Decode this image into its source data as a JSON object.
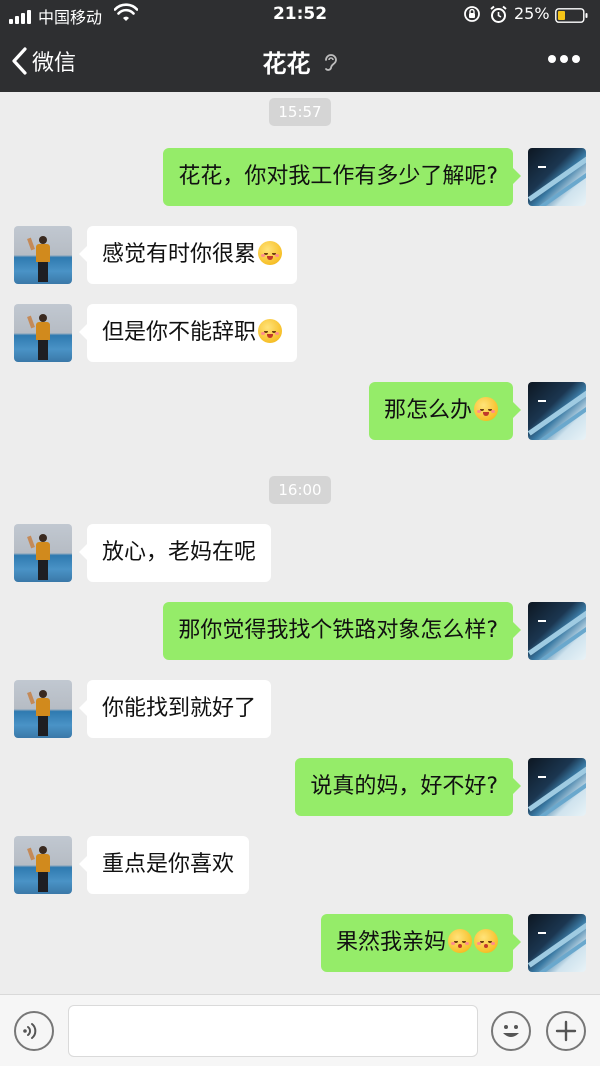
{
  "status_bar": {
    "carrier": "中国移动",
    "time": "21:52",
    "battery": "25%"
  },
  "nav": {
    "back_label": "微信",
    "title": "花花"
  },
  "messages": [
    {
      "type": "timestamp",
      "text": "15:57"
    },
    {
      "type": "out",
      "text": "花花，你对我工作有多少了解呢?"
    },
    {
      "type": "in",
      "text": "感觉有时你很累",
      "emoji": 1
    },
    {
      "type": "in",
      "text": "但是你不能辞职",
      "emoji": 1
    },
    {
      "type": "out",
      "text": "那怎么办",
      "emoji": 1
    },
    {
      "type": "timestamp",
      "text": "16:00"
    },
    {
      "type": "in",
      "text": "放心，老妈在呢"
    },
    {
      "type": "out",
      "text": "那你觉得我找个铁路对象怎么样?"
    },
    {
      "type": "in",
      "text": "你能找到就好了"
    },
    {
      "type": "out",
      "text": "说真的妈，好不好?"
    },
    {
      "type": "in",
      "text": "重点是你喜欢"
    },
    {
      "type": "out",
      "text": "果然我亲妈",
      "emoji": 2
    }
  ],
  "colors": {
    "nav_bg": "#2e2f31",
    "chat_bg": "#ededed",
    "out_bubble": "#95ec69",
    "in_bubble": "#ffffff"
  },
  "icons": {
    "back": "chevron-left-icon",
    "title_badge": "ear-icon",
    "more": "more-dots-icon",
    "voice": "voice-icon",
    "emoji": "emoji-icon",
    "plus": "plus-icon"
  }
}
